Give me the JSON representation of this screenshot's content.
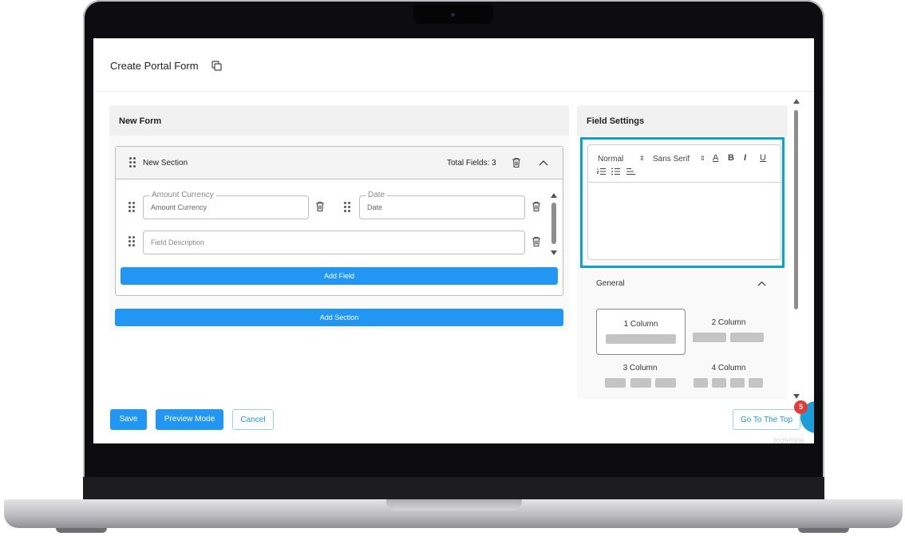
{
  "page": {
    "title": "Create Portal Form",
    "version_text": "20250306"
  },
  "form": {
    "title": "New Form",
    "section": {
      "name": "New Section",
      "total_fields": "Total Fields: 3",
      "fields": [
        {
          "legend": "Amount Currency",
          "value": "Amount Currency"
        },
        {
          "legend": "Date",
          "value": "Date"
        },
        {
          "placeholder": "Field Description"
        }
      ],
      "add_field_label": "Add Field"
    },
    "add_section_label": "Add Section"
  },
  "field_settings": {
    "title": "Field Settings",
    "toolbar": {
      "header_select": "Normal",
      "font_select": "Sans Serif",
      "color_label": "A",
      "bold_label": "B",
      "italic_label": "I",
      "underline_label": "U"
    },
    "general": {
      "label": "General",
      "layouts": [
        "1 Column",
        "2 Column",
        "3 Column",
        "4 Column"
      ],
      "selected_layout": "1 Column"
    }
  },
  "footer": {
    "save_label": "Save",
    "preview_label": "Preview Mode",
    "cancel_label": "Cancel",
    "go_top_label": "Go To The Top",
    "notification_count": "5"
  },
  "colors": {
    "primary": "#2196f3",
    "highlight": "#0aa5c9",
    "badge": "#e53935"
  }
}
